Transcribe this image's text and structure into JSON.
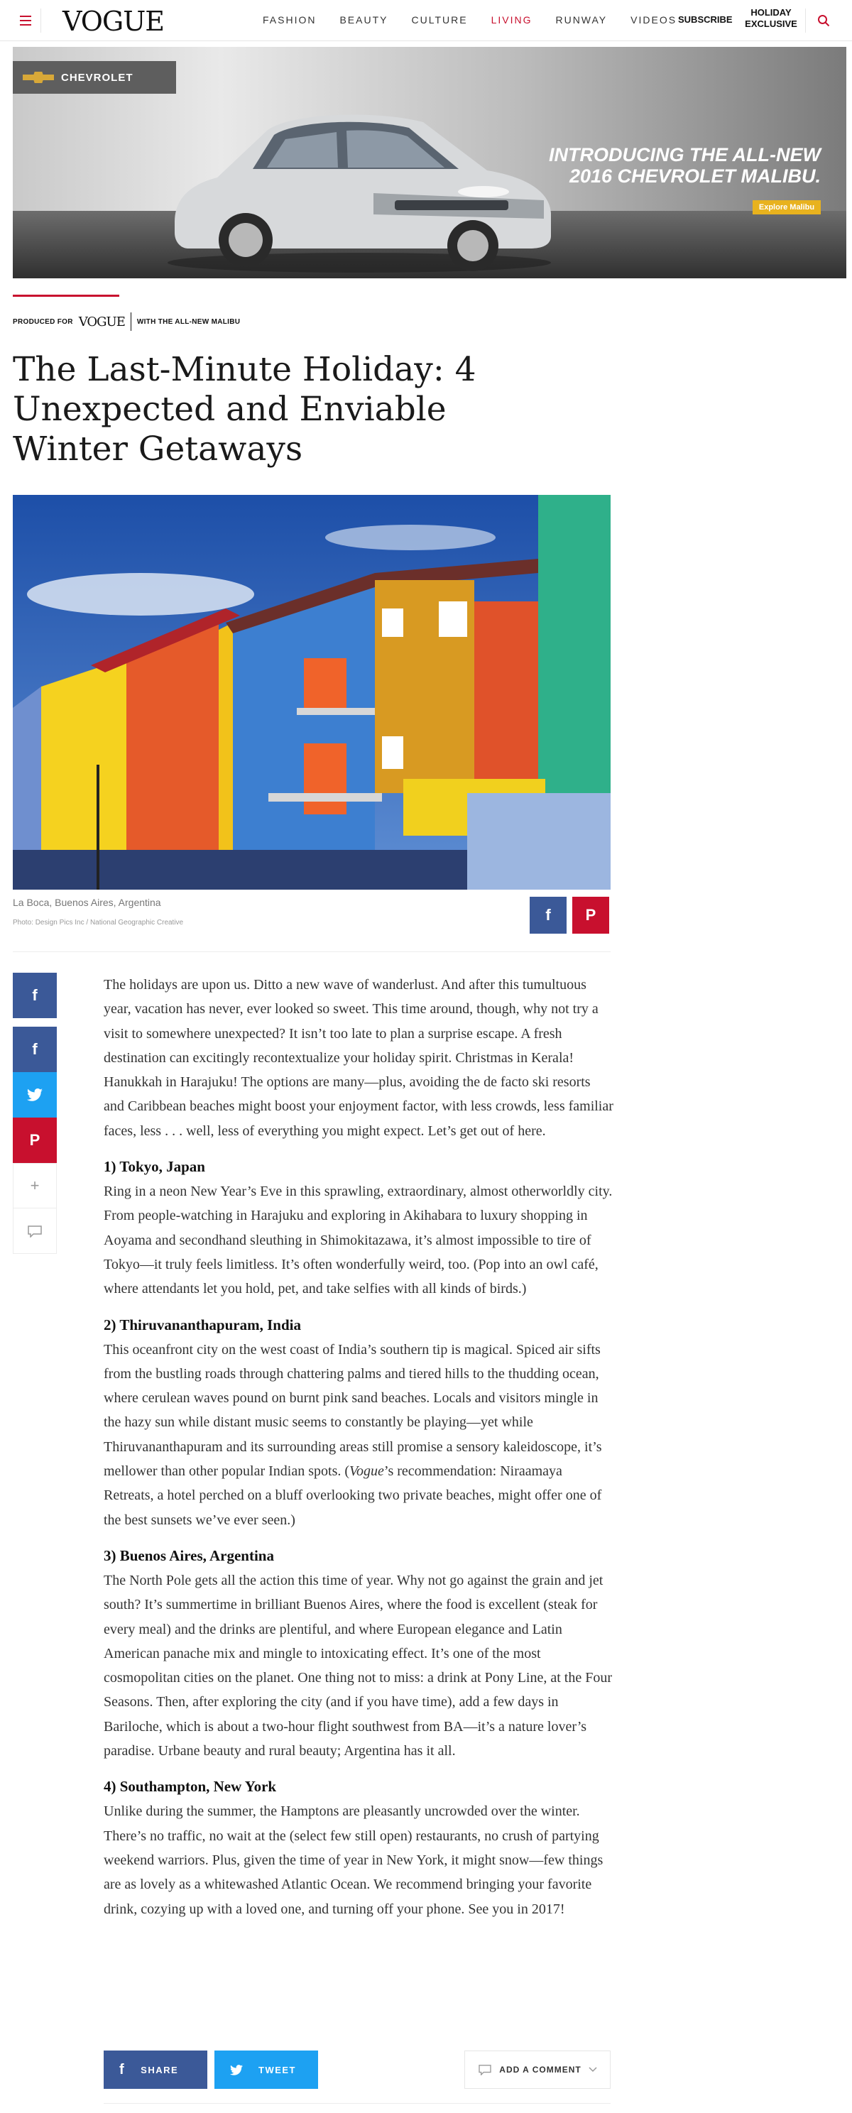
{
  "nav": {
    "logo": "VOGUE",
    "links": [
      "FASHION",
      "BEAUTY",
      "CULTURE",
      "LIVING",
      "RUNWAY",
      "VIDEOS"
    ],
    "active": "LIVING",
    "subscribe": "SUBSCRIBE",
    "holiday_line1": "HOLIDAY",
    "holiday_line2": "EXCLUSIVE",
    "accent_color": "#c8102e"
  },
  "ad": {
    "brand": "CHEVROLET",
    "headline_line1": "INTRODUCING THE ALL-NEW",
    "headline_line2": "2016 CHEVROLET MALIBU.",
    "cta": "Explore Malibu"
  },
  "sponsor": {
    "produced_for": "PRODUCED FOR",
    "logo": "VOGUE",
    "with": "WITH THE ALL-NEW MALIBU"
  },
  "article": {
    "title": "The Last-Minute Holiday: 4 Unexpected and Enviable Winter Getaways",
    "caption": "La Boca, Buenos Aires, Argentina",
    "credit": "Photo: Design Pics Inc / National Geographic Creative",
    "intro": "The holidays are upon us. Ditto a new wave of wanderlust. And after this tumultuous year, vacation has never, ever looked so sweet. This time around, though, why not try a visit to somewhere unexpected? It isn’t too late to plan a surprise escape. A fresh destination can excitingly recontextualize your holiday spirit. Christmas in Kerala! Hanukkah in Harajuku! The options are many—plus, avoiding the de facto ski resorts and Caribbean beaches might boost your enjoyment factor, with less crowds, less familiar faces, less . . . well, less of everything you might expect. Let’s get out of here.",
    "s1_heading": "1) Tokyo, Japan",
    "s1_body": "Ring in a neon New Year’s Eve in this sprawling, extraordinary, almost otherworldly city. From people-watching in Harajuku and exploring in Akihabara to luxury shopping in Aoyama and secondhand sleuthing in Shimokitazawa, it’s almost impossible to tire of Tokyo—it truly feels limitless. It’s often wonderfully weird, too. (Pop into an owl café, where attendants let you hold, pet, and take selfies with all kinds of birds.)",
    "s2_heading": "2) Thiruvananthapuram, India",
    "s2_body_a": "This oceanfront city on the west coast of India’s southern tip is magical. Spiced air sifts from the bustling roads through chattering palms and tiered hills to the thudding ocean, where cerulean waves pound on burnt pink sand beaches. Locals and visitors mingle in the hazy sun while distant music seems to constantly be playing—yet while Thiruvananthapuram and its surrounding areas still promise a sensory kaleidoscope, it’s mellower than other popular Indian spots. (",
    "s2_body_em": "Vogue",
    "s2_body_b": "’s recommendation: Niraamaya Retreats, a hotel perched on a bluff overlooking two private beaches, might offer one of the best sunsets we’ve ever seen.)",
    "s3_heading": "3) Buenos Aires, Argentina",
    "s3_body": "The North Pole gets all the action this time of year. Why not go against the grain and jet south? It’s summertime in brilliant Buenos Aires, where the food is excellent (steak for every meal) and the drinks are plentiful, and where European elegance and Latin American panache mix and mingle to intoxicating effect. It’s one of the most cosmopolitan cities on the planet. One thing not to miss: a drink at Pony Line, at the Four Seasons. Then, after exploring the city (and if you have time), add a few days in Bariloche, which is about a two-hour flight southwest from BA—it’s a nature lover’s paradise. Urbane beauty and rural beauty; Argentina has it all.",
    "s4_heading": "4) Southampton, New York",
    "s4_body": "Unlike during the summer, the Hamptons are pleasantly uncrowded over the winter. There’s no traffic, no wait at the (select few still open) restaurants, no crush of partying weekend warriors. Plus, given the time of year in New York, it might snow—few things are as lovely as a whitewashed Atlantic Ocean. We recommend bringing your favorite drink, cozying up with a loved one, and turning off your phone. See you in 2017!"
  },
  "share": {
    "facebook_glyph": "f",
    "pinterest_glyph": "P",
    "add_glyph": "+",
    "share_label": "SHARE",
    "tweet_label": "TWEET",
    "comment_label": "ADD A COMMENT",
    "facebook_color": "#3b5998",
    "twitter_color": "#1da1f2",
    "pinterest_color": "#c8102e"
  }
}
